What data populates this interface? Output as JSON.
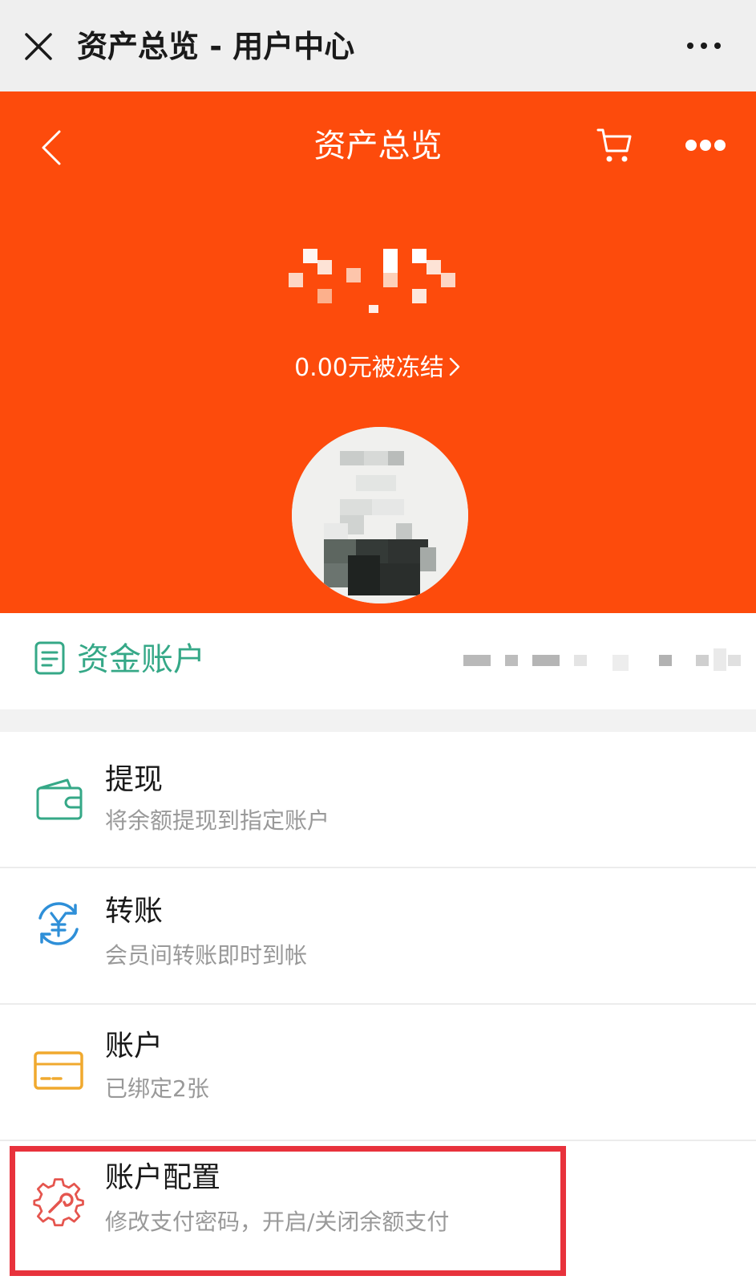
{
  "window": {
    "title": "资产总览 - 用户中心",
    "close_icon": "close-icon",
    "more_icon": "more-dots-icon"
  },
  "header": {
    "title": "资产总览",
    "back_icon": "chevron-left-icon",
    "cart_icon": "cart-icon",
    "more_icon": "more-dots-icon",
    "background_color": "#fd4b0c"
  },
  "balance": {
    "frozen_text": "0.00元被冻结"
  },
  "fund_account": {
    "label": "资金账户",
    "icon": "document-icon",
    "accent_color": "#35a887"
  },
  "menu": [
    {
      "title": "提现",
      "subtitle": "将余额提现到指定账户",
      "icon": "wallet-icon"
    },
    {
      "title": "转账",
      "subtitle": "会员间转账即时到帐",
      "icon": "yuan-transfer-icon"
    },
    {
      "title": "账户",
      "subtitle": "已绑定2张",
      "icon": "bank-card-icon"
    },
    {
      "title": "账户配置",
      "subtitle": "修改支付密码，开启/关闭余额支付",
      "icon": "gear-wrench-icon"
    }
  ]
}
